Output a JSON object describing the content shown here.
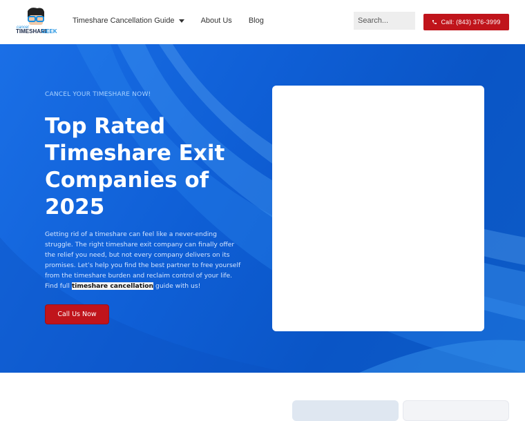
{
  "header": {
    "logo": {
      "alt": "Timeshare Geek",
      "line1": "cancel",
      "line2": "TIMESHARE",
      "line3": "GEEK"
    },
    "nav": [
      {
        "label": "Timeshare Cancellation Guide",
        "has_dropdown": true
      },
      {
        "label": "About Us",
        "has_dropdown": false
      },
      {
        "label": "Blog",
        "has_dropdown": false
      }
    ],
    "search": {
      "placeholder": "Search..."
    },
    "call_button": {
      "label": "Call: (843) 376-3999",
      "icon": "phone-icon"
    }
  },
  "hero": {
    "eyebrow": "CANCEL YOUR TIMESHARE NOW!",
    "title_lines": [
      "Top Rated",
      "Timeshare Exit",
      "Companies of",
      "2025"
    ],
    "description_before": "Getting rid of a timeshare can feel like a never-ending struggle. The right timeshare exit company can finally offer the relief you need, but not every company delivers on its promises. Let’s help you find the best partner to free yourself from the timeshare burden and reclaim control of your life. Find full ",
    "description_link": "timeshare cancellation",
    "description_after": " guide with us!",
    "cta_label": "Call Us Now"
  },
  "colors": {
    "accent": "#c0141b",
    "hero_bg": "#0f5fd6",
    "eyebrow": "#a9d2ff"
  }
}
